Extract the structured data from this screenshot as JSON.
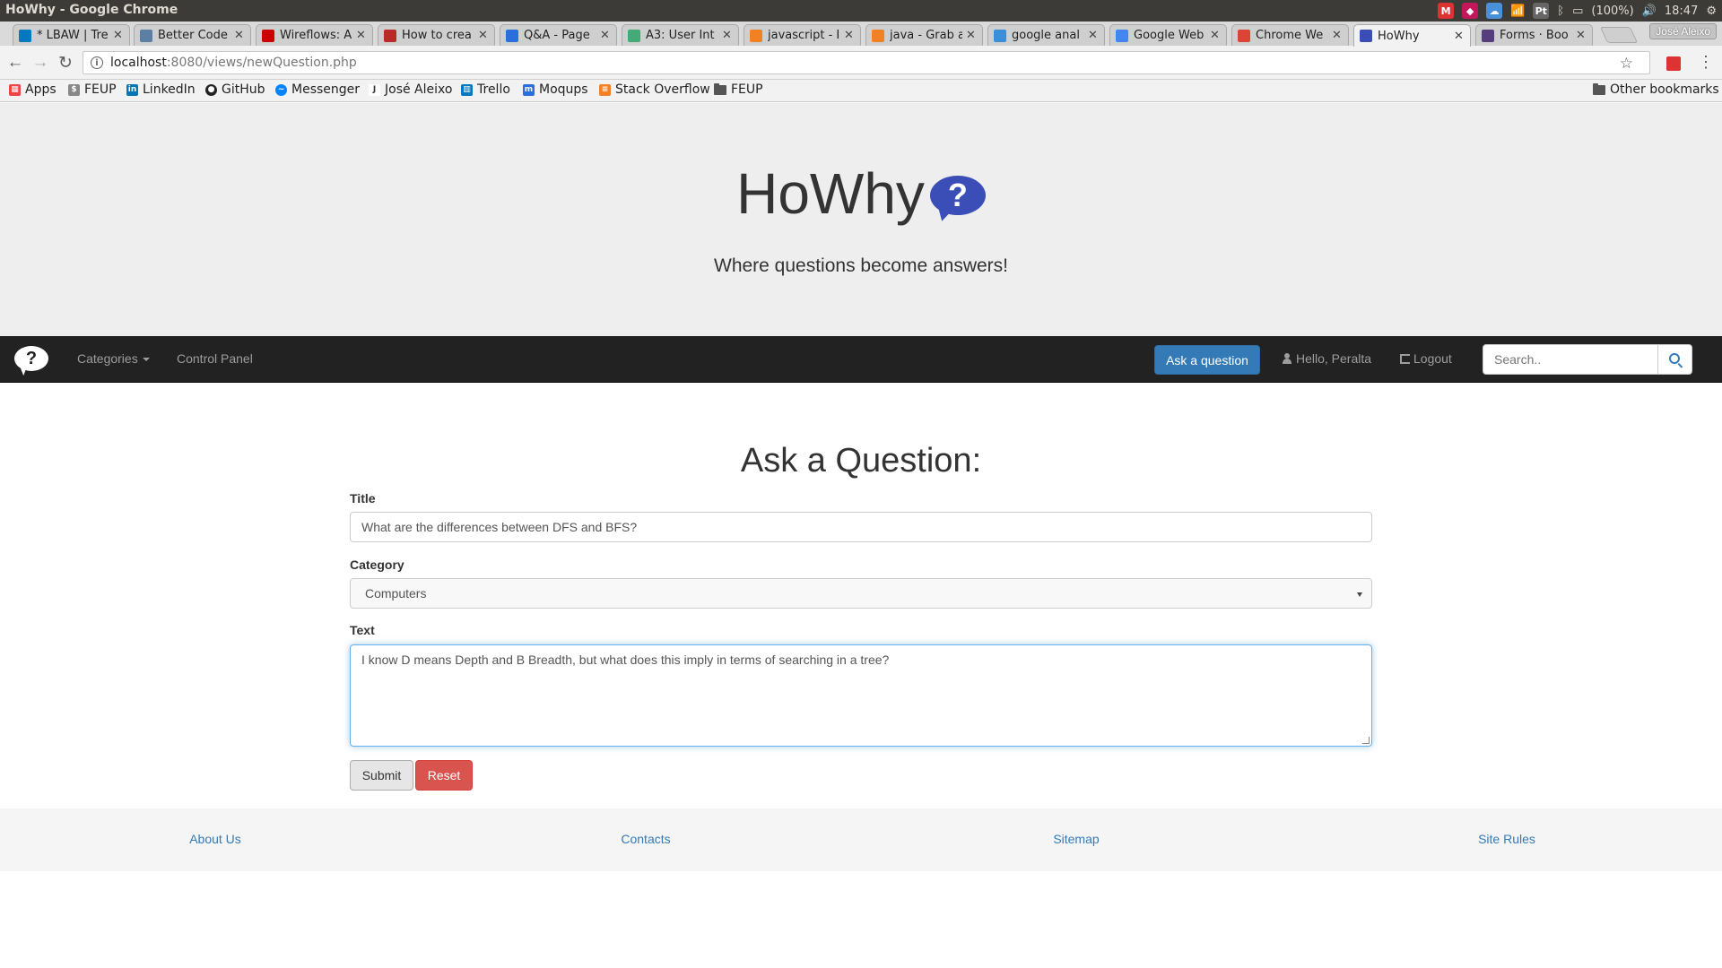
{
  "os": {
    "window_title": "HoWhy - Google Chrome",
    "battery": "(100%)",
    "clock": "18:47",
    "lang_indicator": "Pt"
  },
  "browser": {
    "profile_name": "José Aleixo",
    "tabs": [
      {
        "label": "* LBAW | Tre",
        "icon": "trello-icon",
        "color": "#0079bf"
      },
      {
        "label": "Better Code",
        "icon": "check-icon",
        "color": "#5c7fa3"
      },
      {
        "label": "Wireflows: A",
        "icon": "nn-icon",
        "color": "#c00"
      },
      {
        "label": "How to crea",
        "icon": "quora-icon",
        "color": "#b92b27"
      },
      {
        "label": "Q&A - Page",
        "icon": "moqups-icon",
        "color": "#2a6fdb"
      },
      {
        "label": "A3: User Int",
        "icon": "pencil-icon",
        "color": "#4a7"
      },
      {
        "label": "javascript - I",
        "icon": "stackoverflow-icon",
        "color": "#f48024"
      },
      {
        "label": "java - Grab a",
        "icon": "stackoverflow-icon",
        "color": "#f48024"
      },
      {
        "label": "google anal",
        "icon": "analytics-icon",
        "color": "#3a8fd8"
      },
      {
        "label": "Google Web",
        "icon": "google-icon",
        "color": "#4285f4"
      },
      {
        "label": "Chrome We",
        "icon": "chrome-icon",
        "color": "#db4437"
      },
      {
        "label": "HoWhy",
        "icon": "howhy-icon",
        "color": "#3b4eb8",
        "active": true
      },
      {
        "label": "Forms · Boo",
        "icon": "bootstrap-icon",
        "color": "#563d7c"
      }
    ],
    "url_host": "localhost",
    "url_path": ":8080/views/newQuestion.php",
    "bookmarks": [
      {
        "label": "Apps",
        "icon": "apps-grid-icon"
      },
      {
        "label": "FEUP",
        "icon": "feup-icon"
      },
      {
        "label": "LinkedIn",
        "icon": "linkedin-icon"
      },
      {
        "label": "GitHub",
        "icon": "github-icon"
      },
      {
        "label": "Messenger",
        "icon": "messenger-icon"
      },
      {
        "label": "José Aleixo",
        "icon": "j-icon"
      },
      {
        "label": "Trello",
        "icon": "trello-icon"
      },
      {
        "label": "Moqups",
        "icon": "moqups-icon"
      },
      {
        "label": "Stack Overflow",
        "icon": "stackoverflow-icon"
      },
      {
        "label": "FEUP",
        "icon": "folder-icon"
      }
    ],
    "other_bookmarks": "Other bookmarks"
  },
  "site": {
    "brand": "HoWhy",
    "tagline": "Where questions become answers!",
    "accent": "#3b4eb8"
  },
  "navbar": {
    "categories": "Categories",
    "control_panel": "Control Panel",
    "ask_button": "Ask a question",
    "greeting": "Hello, Peralta",
    "logout": "Logout",
    "search_placeholder": "Search.."
  },
  "form": {
    "heading": "Ask a Question:",
    "title_label": "Title",
    "title_value": "What are the differences between DFS and BFS?",
    "category_label": "Category",
    "category_value": "Computers",
    "text_label": "Text",
    "text_value": "I know D means Depth and B Breadth, but what does this imply in terms of searching in a tree?",
    "submit": "Submit",
    "reset": "Reset"
  },
  "footer": {
    "links": [
      "About Us",
      "Contacts",
      "Sitemap",
      "Site Rules"
    ]
  }
}
